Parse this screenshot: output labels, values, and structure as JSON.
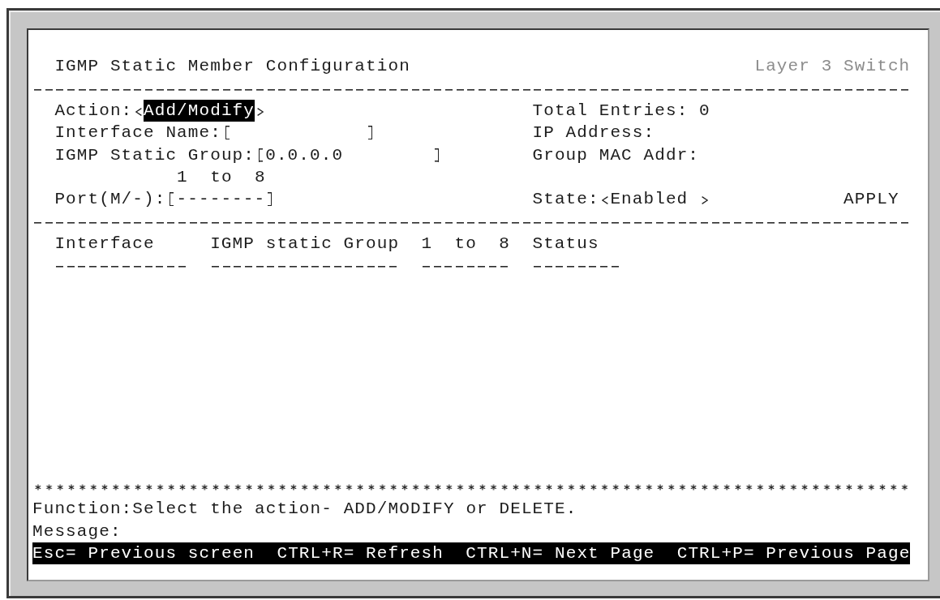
{
  "screen": {
    "title": "IGMP Static Member Configuration",
    "device": "Layer 3 Switch"
  },
  "form": {
    "action": {
      "label": "Action:",
      "value": "Add/Modify",
      "focused": true
    },
    "total_entries": {
      "label": "Total Entries:",
      "value": "0"
    },
    "interface_name": {
      "label": "Interface Name:"
    },
    "ip_address": {
      "label": "IP Address:"
    },
    "igmp_static_group": {
      "label": "IGMP Static Group:",
      "value": "0.0.0.0"
    },
    "group_mac_addr": {
      "label": "Group MAC Addr:"
    },
    "port_range": "1  to  8",
    "port": {
      "label": "Port(M/-):",
      "value": "--------"
    },
    "state": {
      "label": "State:",
      "value": "Enabled",
      "focused": false
    },
    "apply_button": "APPLY"
  },
  "table": {
    "columns": [
      "Interface",
      "IGMP static Group",
      "1  to  8",
      "Status"
    ]
  },
  "footer": {
    "function_label": "Function:",
    "function_text": "Select the action- ADD/MODIFY or DELETE.",
    "message_label": "Message:"
  },
  "key_hints": [
    "Esc= Previous screen",
    "CTRL+R= Refresh",
    "CTRL+N= Next Page",
    "CTRL+P= Previous Page"
  ]
}
